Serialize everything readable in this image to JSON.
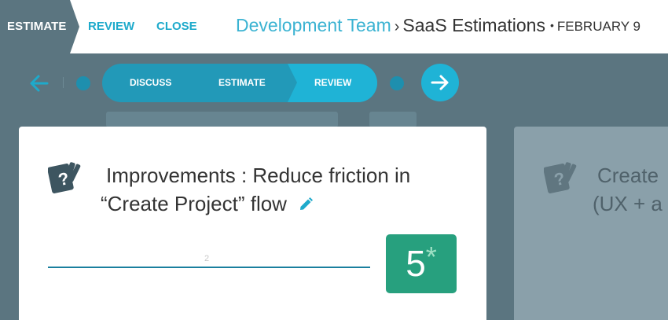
{
  "nav": {
    "active_tab": "ESTIMATE",
    "review": "REVIEW",
    "close": "CLOSE"
  },
  "breadcrumb": {
    "team": "Development Team",
    "separator": "›",
    "project": "SaaS Estimations",
    "dot": "•",
    "date": "FEBRUARY 9"
  },
  "stepper": {
    "steps": [
      "DISCUSS",
      "ESTIMATE",
      "REVIEW"
    ],
    "active_step": "REVIEW"
  },
  "card": {
    "title_line1": "Improvements : Reduce friction in",
    "title_line2": "“Create Project” flow",
    "vote_label": "2",
    "score": "5",
    "score_suffix": "*"
  },
  "card2": {
    "title_line1": "Create",
    "title_line2": "(UX + a"
  },
  "colors": {
    "accent": "#1fb3d6",
    "score_green": "#27a07e",
    "background": "#5b7580"
  }
}
